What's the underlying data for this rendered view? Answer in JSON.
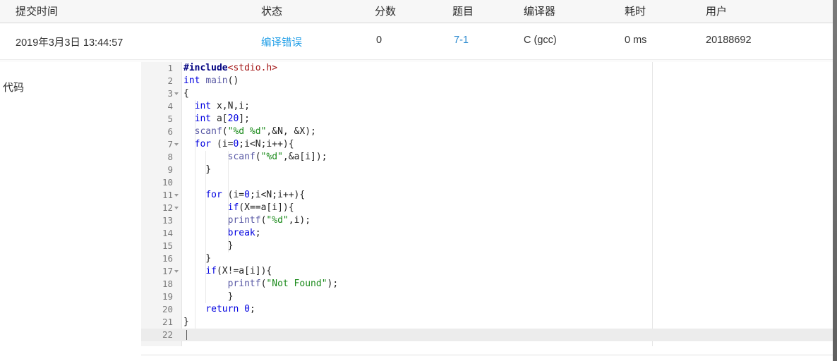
{
  "table": {
    "headers": [
      {
        "key": "time",
        "label": "提交时间"
      },
      {
        "key": "state",
        "label": "状态"
      },
      {
        "key": "score",
        "label": "分数"
      },
      {
        "key": "prob",
        "label": "题目"
      },
      {
        "key": "comp",
        "label": "编译器"
      },
      {
        "key": "cost",
        "label": "耗时"
      },
      {
        "key": "user",
        "label": "用户"
      }
    ],
    "row": {
      "time": "2019年3月3日 13:44:57",
      "state": "编译错误",
      "score": "0",
      "prob": "7-1",
      "comp": "C (gcc)",
      "cost": "0 ms",
      "user": "20188692"
    }
  },
  "code_section": {
    "label": "代码"
  },
  "editor": {
    "language": "c",
    "total_lines": 22,
    "current_line": 22,
    "fold_markers": [
      3,
      7,
      11,
      12,
      17
    ],
    "lines": [
      {
        "n": "1",
        "text": "#include<stdio.h>"
      },
      {
        "n": "2",
        "text": "int main()"
      },
      {
        "n": "3",
        "text": "{"
      },
      {
        "n": "4",
        "text": "  int x,N,i;"
      },
      {
        "n": "5",
        "text": "  int a[20];"
      },
      {
        "n": "6",
        "text": "  scanf(\"%d %d\",&N, &X);"
      },
      {
        "n": "7",
        "text": "  for (i=0;i<N;i++){"
      },
      {
        "n": "8",
        "text": "        scanf(\"%d\",&a[i]);"
      },
      {
        "n": "9",
        "text": "    }"
      },
      {
        "n": "10",
        "text": ""
      },
      {
        "n": "11",
        "text": "    for (i=0;i<N;i++){"
      },
      {
        "n": "12",
        "text": "        if(X==a[i]){"
      },
      {
        "n": "13",
        "text": "        printf(\"%d\",i);"
      },
      {
        "n": "14",
        "text": "        break;"
      },
      {
        "n": "15",
        "text": "        }"
      },
      {
        "n": "16",
        "text": "    }"
      },
      {
        "n": "17",
        "text": "    if(X!=a[i]){"
      },
      {
        "n": "18",
        "text": "        printf(\"Not Found\");"
      },
      {
        "n": "19",
        "text": "        }"
      },
      {
        "n": "20",
        "text": "    return 0;"
      },
      {
        "n": "21",
        "text": "}"
      },
      {
        "n": "22",
        "text": ""
      }
    ]
  },
  "colors": {
    "header_bg": "#f7f7f7",
    "link_blue": "#24a0e8",
    "problem_blue": "#2e8bd0",
    "gutter_bg": "#f4f4f4",
    "current_line_bg": "#ececec",
    "keyword": "#0000e0",
    "string": "#1a8a1a",
    "preprocessor": "#000080",
    "include_path": "#a31515",
    "function": "#5a5aa5"
  }
}
